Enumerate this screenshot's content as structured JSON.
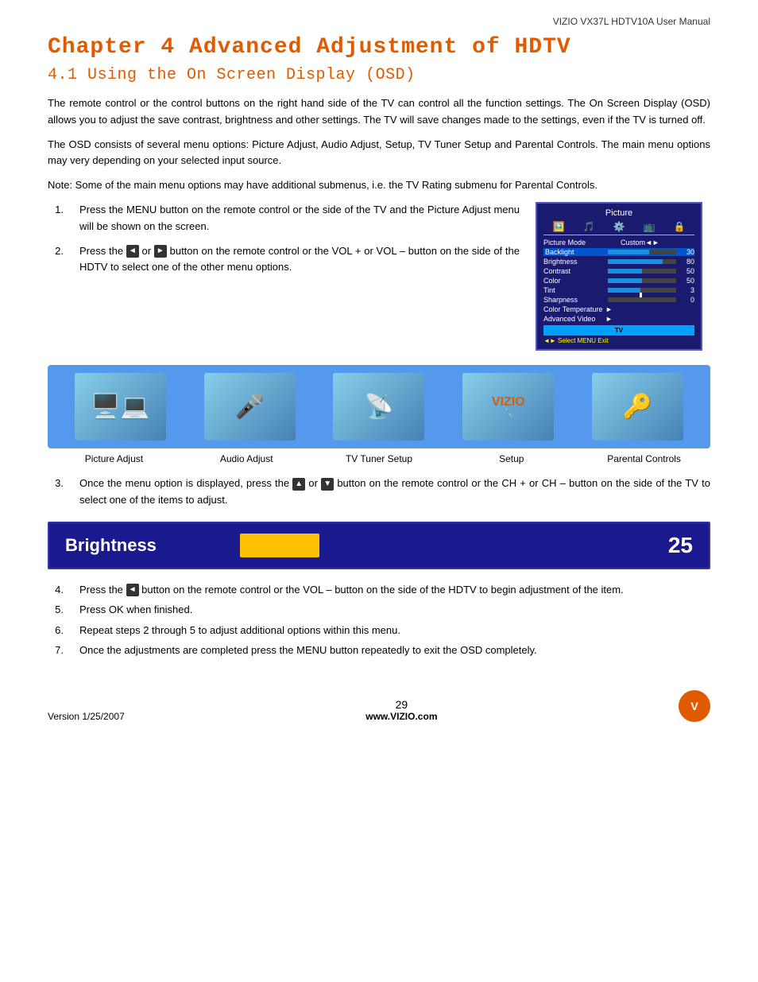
{
  "header": {
    "right_text": "VIZIO VX37L HDTV10A User Manual"
  },
  "chapter": {
    "title": "Chapter 4 Advanced Adjustment of HDTV",
    "section": "4.1 Using the On Screen Display (OSD)"
  },
  "intro_paragraphs": [
    "The remote control or the control buttons on the right hand side of the TV can control all the function settings.  The On Screen Display (OSD) allows you to adjust the save contrast, brightness and other settings.  The TV will save changes made to the settings, even if the TV is turned off.",
    "The OSD consists of several menu options: Picture Adjust, Audio Adjust, Setup, TV Tuner Setup and Parental Controls.  The main menu options may very depending on your selected input source.",
    "Note:  Some of the main menu options may have additional submenus, i.e. the TV Rating submenu for Parental Controls."
  ],
  "steps": [
    {
      "num": "1.",
      "text": "Press the MENU button on the remote control or the side of the TV and the Picture Adjust menu will be shown on the screen."
    },
    {
      "num": "2.",
      "text": "Press the  or  button on the remote control or the VOL + or VOL – button on the side of the HDTV to select one of the other menu options."
    }
  ],
  "osd_menu": {
    "title": "Picture",
    "rows": [
      {
        "label": "Picture Mode",
        "type": "text",
        "value": "Custom"
      },
      {
        "label": "Backlight",
        "type": "bar",
        "fill": 60,
        "value": "30",
        "active": true
      },
      {
        "label": "Brightness",
        "type": "bar",
        "fill": 80,
        "value": "80"
      },
      {
        "label": "Contrast",
        "type": "bar",
        "fill": 50,
        "value": "50"
      },
      {
        "label": "Color",
        "type": "bar",
        "fill": 50,
        "value": "50"
      },
      {
        "label": "Tint",
        "type": "bar",
        "fill": 50,
        "value": "3",
        "dot": true
      },
      {
        "label": "Sharpness",
        "type": "bar",
        "fill": 0,
        "value": "0"
      },
      {
        "label": "Color Temperature",
        "type": "arrow"
      },
      {
        "label": "Advanced Video",
        "type": "arrow"
      }
    ],
    "bottom": "TV",
    "footer": "◄► Select  MENU Exit"
  },
  "menu_categories": [
    {
      "label": "Picture Adjust",
      "icon": "🖥️"
    },
    {
      "label": "Audio Adjust",
      "icon": "🎤"
    },
    {
      "label": "TV Tuner Setup",
      "icon": "📡"
    },
    {
      "label": "Setup",
      "icon": "VIZIO"
    },
    {
      "label": "Parental Controls",
      "icon": "🔑"
    }
  ],
  "step3": {
    "num": "3.",
    "text": "Once the menu option is displayed, press the  or  button on the remote control or the CH + or CH – button on the side of the TV to select one of the items to adjust."
  },
  "brightness_bar": {
    "label": "Brightness",
    "value": "25"
  },
  "bottom_steps": [
    {
      "num": "4.",
      "text": "Press the  button on the remote control or the VOL – button on the side of the HDTV to begin adjustment of the item."
    },
    {
      "num": "5.",
      "text": "Press OK when finished."
    },
    {
      "num": "6.",
      "text": "Repeat steps 2 through 5 to adjust additional options within this menu."
    },
    {
      "num": "7.",
      "text": "Once the adjustments are completed press the MENU button repeatedly to exit the OSD completely."
    }
  ],
  "footer": {
    "version": "Version 1/25/2007",
    "page": "29",
    "website": "www.VIZIO.com",
    "logo": "V"
  }
}
